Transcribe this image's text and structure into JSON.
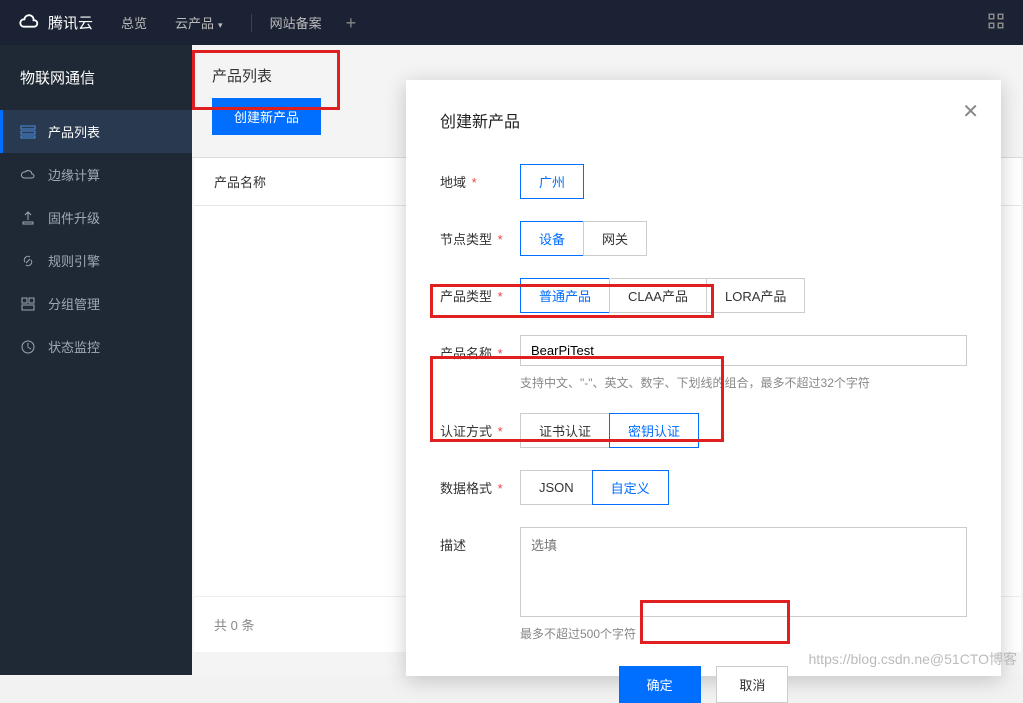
{
  "header": {
    "brand": "腾讯云",
    "nav": {
      "overview": "总览",
      "products": "云产品",
      "beian": "网站备案"
    }
  },
  "sidebar": {
    "title": "物联网通信",
    "items": [
      {
        "label": "产品列表",
        "icon": "list"
      },
      {
        "label": "边缘计算",
        "icon": "cloud"
      },
      {
        "label": "固件升级",
        "icon": "upgrade"
      },
      {
        "label": "规则引擎",
        "icon": "link"
      },
      {
        "label": "分组管理",
        "icon": "group"
      },
      {
        "label": "状态监控",
        "icon": "monitor"
      }
    ]
  },
  "main": {
    "title": "产品列表",
    "create_btn": "创建新产品",
    "col_name": "产品名称",
    "total": "共 0 条"
  },
  "modal": {
    "title": "创建新产品",
    "region_label": "地域",
    "region_opts": [
      "广州"
    ],
    "node_label": "节点类型",
    "node_opts": [
      "设备",
      "网关"
    ],
    "ptype_label": "产品类型",
    "ptype_opts": [
      "普通产品",
      "CLAA产品",
      "LORA产品"
    ],
    "pname_label": "产品名称",
    "pname_value": "BearPiTest",
    "pname_hint": "支持中文、\"-\"、英文、数字、下划线的组合，最多不超过32个字符",
    "auth_label": "认证方式",
    "auth_opts": [
      "证书认证",
      "密钥认证"
    ],
    "format_label": "数据格式",
    "format_opts": [
      "JSON",
      "自定义"
    ],
    "desc_label": "描述",
    "desc_placeholder": "选填",
    "desc_hint": "最多不超过500个字符",
    "ok": "确定",
    "cancel": "取消"
  },
  "watermark": "https://blog.csdn.ne@51CTO博客"
}
